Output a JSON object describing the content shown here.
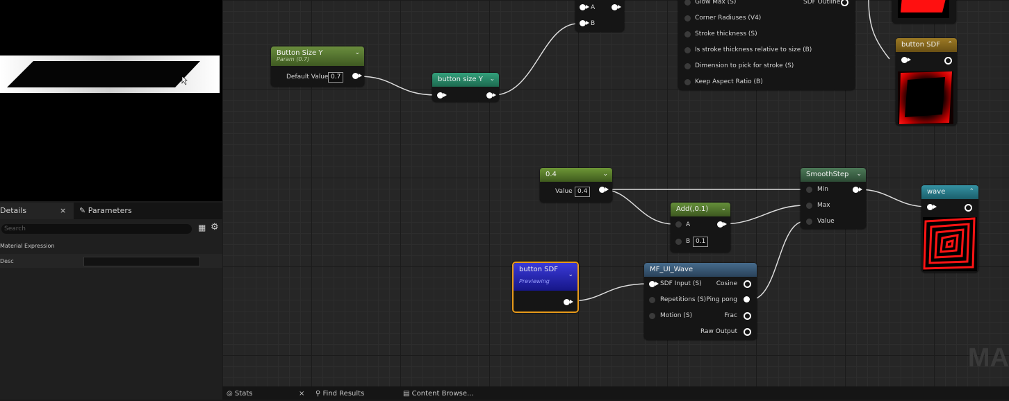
{
  "details_panel": {
    "tab_details": "Details",
    "tab_parameters": "Parameters",
    "search_placeholder": "Search",
    "category": "Material Expression",
    "desc_label": "Desc",
    "close": "×"
  },
  "nodes": {
    "button_size_y_param": {
      "title": "Button Size Y",
      "subtitle": "Param (0.7)",
      "pin_label": "Default Value",
      "value": "0.7"
    },
    "button_size_y_reroute": {
      "title": "button size Y"
    },
    "top_mid": {
      "pin_a": "A",
      "pin_b": "B"
    },
    "top_sdf": {
      "inputs": [
        "Glow Max (S)",
        "Corner Radiuses (V4)",
        "Stroke thickness (S)",
        "Is stroke thickness relative to size (B)",
        "Dimension to pick for stroke (S)",
        "Keep Aspect Ratio (B)"
      ],
      "output": "SDF Outline"
    },
    "button_sdf_preview": {
      "title": "button SDF"
    },
    "const_04": {
      "title": "0.4",
      "pin_label": "Value",
      "value": "0.4"
    },
    "add": {
      "title": "Add(,0.1)",
      "pin_a": "A",
      "pin_b": "B",
      "b_value": "0.1"
    },
    "smoothstep": {
      "title": "SmoothStep",
      "pins": [
        "Min",
        "Max",
        "Value"
      ]
    },
    "wave_preview": {
      "title": "wave"
    },
    "button_sdf_named": {
      "title": "button SDF",
      "subtitle": "Previewing"
    },
    "mf_ui_wave": {
      "title": "MF_UI_Wave",
      "inputs": [
        "SDF Input (S)",
        "Repetitions (S)",
        "Motion (S)"
      ],
      "outputs": [
        "Cosine",
        "Ping pong",
        "Frac",
        "Raw Output"
      ]
    }
  },
  "statusbar": {
    "stats": "Stats",
    "find_results": "Find Results",
    "content_browser": "Content Browse...",
    "close": "×"
  },
  "watermark": "MA",
  "colors": {
    "param_header": "#5a7a33",
    "reroute_header": "#2d8a6a",
    "const_header": "#557a2a",
    "add_header": "#4f7029",
    "smoothstep_header": "#3f6448",
    "function_header": "#3a5a78",
    "preview_header": "#8a6a1e",
    "wave_header": "#2c7a8a",
    "named_header": "#2323b5",
    "selection": "#e89a1a",
    "preview_red": "#ff1010"
  }
}
